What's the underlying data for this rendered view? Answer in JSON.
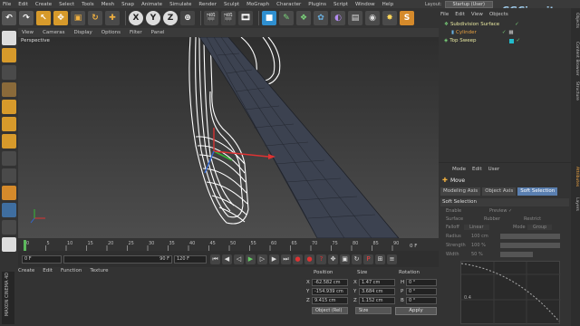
{
  "menubar": [
    "File",
    "Edit",
    "Create",
    "Select",
    "Tools",
    "Mesh",
    "Snap",
    "Animate",
    "Simulate",
    "Render",
    "Sculpt",
    "MoGraph",
    "Character",
    "Plugins",
    "Script",
    "Window",
    "Help"
  ],
  "layout": {
    "label": "Layout:",
    "value": "Startup (User)"
  },
  "watermark": "CGCircuit",
  "viewport": {
    "menu": [
      "View",
      "Cameras",
      "Display",
      "Options",
      "Filter",
      "Panel"
    ],
    "label": "Perspective"
  },
  "timeline": {
    "ticks": [
      "0",
      "5",
      "10",
      "15",
      "20",
      "25",
      "30",
      "35",
      "40",
      "45",
      "50",
      "55",
      "60",
      "65",
      "70",
      "75",
      "80",
      "85",
      "90"
    ],
    "end_frame": "0 F",
    "start_field": "0 F",
    "current_field": "0 F",
    "min_field": "90 F",
    "max_field": "120 F"
  },
  "material_menu": [
    "Create",
    "Edit",
    "Function",
    "Texture"
  ],
  "branding": "MAXON CINEMA 4D",
  "coords": {
    "headers": {
      "position": "Position",
      "size": "Size",
      "rotation": "Rotation"
    },
    "rows": [
      {
        "axis": "X",
        "pos": "-62.582 cm",
        "size": "1.47 cm",
        "rot_axis": "H",
        "rot": "0 °"
      },
      {
        "axis": "Y",
        "pos": "-154.939 cm",
        "size": "3.684 cm",
        "rot_axis": "P",
        "rot": "0 °"
      },
      {
        "axis": "Z",
        "pos": "9.415 cm",
        "size": "1.152 cm",
        "rot_axis": "B",
        "rot": "0 °"
      }
    ],
    "mode_select": "Object (Rel)",
    "size_select": "Size",
    "apply": "Apply"
  },
  "object_manager": {
    "menu": [
      "File",
      "Edit",
      "View",
      "Objects"
    ],
    "objects": [
      {
        "name": "Subdivision Surface"
      },
      {
        "name": "Cylinder"
      },
      {
        "name": "Top Sweep"
      }
    ]
  },
  "attribute_manager": {
    "menu": [
      "Mode",
      "Edit",
      "User"
    ],
    "title": "Move",
    "tabs": [
      "Modeling Axis",
      "Object Axis",
      "Soft Selection"
    ],
    "section": "Soft Selection",
    "rows": [
      {
        "a": "Enable",
        "b": "Preview ✓"
      },
      {
        "a": "Surface",
        "b": "Rubber",
        "c": "Restrict"
      },
      {
        "a": "Falloff",
        "b": "Linear",
        "c": "Mode",
        "d": "Group"
      },
      {
        "a": "Radius",
        "b": "100 cm"
      },
      {
        "a": "Strength",
        "b": "100 %"
      },
      {
        "a": "Width",
        "b": "50 %"
      }
    ],
    "graph_label": "0.4"
  },
  "side_tabs": [
    "Objects",
    "Content Browser",
    "Structure",
    "Attributes",
    "Layers"
  ]
}
